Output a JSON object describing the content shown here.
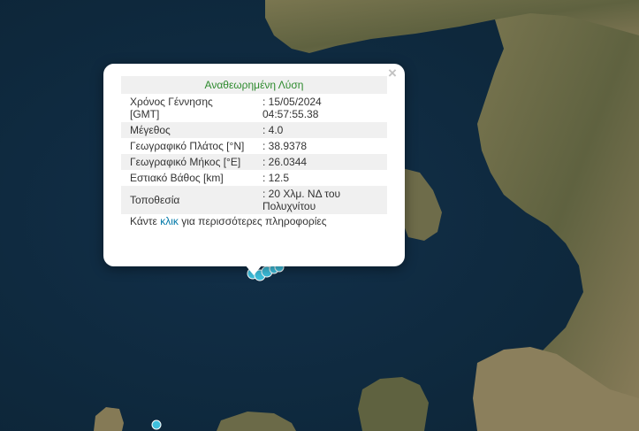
{
  "popup": {
    "close_symbol": "×",
    "header": "Αναθεωρημένη Λύση",
    "rows": [
      {
        "label": "Χρόνος Γέννησης [GMT]",
        "value": ": 15/05/2024 04:57:55.38"
      },
      {
        "label": "Μέγεθος",
        "value": ": 4.0"
      },
      {
        "label": "Γεωγραφικό Πλάτος [°N]",
        "value": ": 38.9378"
      },
      {
        "label": "Γεωγραφικό Μήκος [°E]",
        "value": ": 26.0344"
      },
      {
        "label": "Εστιακό Βάθος [km]",
        "value": ": 12.5"
      },
      {
        "label": "Τοποθεσία",
        "value": ": 20 Χλμ. ΝΔ του Πολυχνίτου"
      }
    ],
    "note_prefix": "Κάντε ",
    "note_link": "κλικ",
    "note_suffix": " για περισσότερες πληροφορίες"
  },
  "colors": {
    "sea": "#0f2a3e",
    "land": "#6b6a48",
    "marker": "#3ec0de",
    "header_text": "#2d8a2d",
    "link": "#0078a8"
  }
}
